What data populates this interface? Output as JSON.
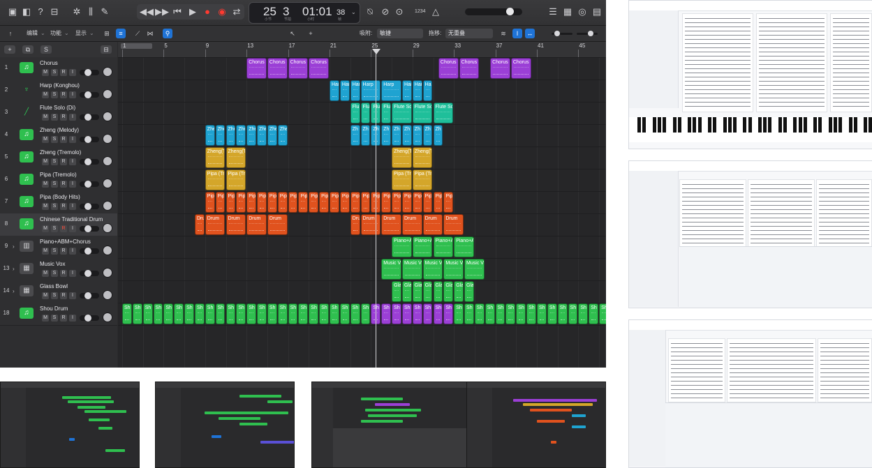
{
  "transport": {
    "bars": "25",
    "beats": "3",
    "time": "01:01",
    "frames": "38",
    "bars_label": "小节",
    "beats_label": "节拍",
    "time_label": "小时",
    "frames_label": "帧",
    "sig": "1234",
    "key_sig": "4"
  },
  "toolbar": {
    "edit": "编辑",
    "functions": "功能",
    "view": "显示",
    "snap_label": "吸附:",
    "snap_value": "敏捷",
    "drag_label": "拖移:",
    "drag_value": "无重叠"
  },
  "ruler": [
    "1",
    "5",
    "9",
    "13",
    "17",
    "21",
    "25",
    "29",
    "33",
    "37",
    "41",
    "45"
  ],
  "tracks": [
    {
      "num": "1",
      "name": "Chorus",
      "icon": "music-note-icon"
    },
    {
      "num": "2",
      "name": "Harp (Konghou)",
      "icon": "harp-icon"
    },
    {
      "num": "3",
      "name": "Flute Solo (Di)",
      "icon": "flute-icon"
    },
    {
      "num": "4",
      "name": "Zheng (Melody)",
      "icon": "music-note-icon"
    },
    {
      "num": "5",
      "name": "Zheng (Tremolo)",
      "icon": "music-note-icon"
    },
    {
      "num": "6",
      "name": "Pipa (Tremolo)",
      "icon": "music-note-icon"
    },
    {
      "num": "7",
      "name": "Pipa (Body Hits)",
      "icon": "music-note-icon"
    },
    {
      "num": "8",
      "name": "Chinese Traditional Drum",
      "icon": "music-note-icon"
    },
    {
      "num": "9",
      "name": "Piano+ABM+Chorus",
      "icon": "piano-icon"
    },
    {
      "num": "13",
      "name": "Music Vox",
      "icon": "keyboard-icon"
    },
    {
      "num": "14",
      "name": "Glass Bowl",
      "icon": "keyboard-icon"
    },
    {
      "num": "18",
      "name": "Shou Drum",
      "icon": "music-note-icon"
    }
  ],
  "track_buttons": {
    "mute": "M",
    "solo": "S",
    "record": "R",
    "input": "I"
  },
  "regions": [
    {
      "row": 0,
      "label": "Chorus",
      "color": "#9b3fd6",
      "bars": [
        [
          25,
          29
        ],
        [
          29,
          33
        ],
        [
          33,
          37
        ],
        [
          37,
          41
        ]
      ]
    },
    {
      "row": 0,
      "label": "Chorus",
      "color": "#9b3fd6",
      "bars": [
        [
          62,
          66
        ],
        [
          66,
          70
        ]
      ]
    },
    {
      "row": 0,
      "label": "Chorus",
      "color": "#9b3fd6",
      "bars": [
        [
          72,
          76
        ],
        [
          76,
          80
        ]
      ]
    },
    {
      "row": 1,
      "label": "Har",
      "color": "#1fa3d1",
      "bars": [
        [
          41,
          43
        ],
        [
          43,
          45
        ],
        [
          45,
          47
        ],
        [
          47,
          49
        ],
        [
          49,
          51
        ],
        [
          51,
          53
        ],
        [
          53,
          55
        ],
        [
          55,
          57
        ],
        [
          57,
          59
        ],
        [
          59,
          61
        ]
      ]
    },
    {
      "row": 1,
      "label": "Har",
      "color": "#1fa3d1",
      "bars": [
        [
          45,
          47
        ],
        [
          47,
          49
        ],
        [
          49,
          51
        ],
        [
          51,
          53
        ]
      ]
    },
    {
      "row": 1,
      "label": "Harp",
      "color": "#1fa3d1",
      "bars": [
        [
          47,
          51
        ],
        [
          51,
          55
        ]
      ]
    },
    {
      "row": 2,
      "label": "Flu",
      "color": "#1fbf9a",
      "bars": [
        [
          45,
          47
        ],
        [
          47,
          49
        ],
        [
          49,
          51
        ],
        [
          51,
          53
        ]
      ]
    },
    {
      "row": 2,
      "label": "Flute So",
      "color": "#1fbf9a",
      "bars": [
        [
          53,
          57
        ],
        [
          57,
          61
        ],
        [
          61,
          65
        ]
      ]
    },
    {
      "row": 3,
      "label": "Zhe",
      "color": "#1fa3d1",
      "bars": [
        [
          17,
          19
        ],
        [
          19,
          21
        ],
        [
          21,
          23
        ],
        [
          23,
          25
        ],
        [
          25,
          27
        ],
        [
          27,
          29
        ],
        [
          29,
          31
        ],
        [
          31,
          33
        ]
      ]
    },
    {
      "row": 3,
      "label": "Zh",
      "color": "#1fa3d1",
      "bars": [
        [
          45,
          47
        ],
        [
          47,
          49
        ],
        [
          49,
          51
        ],
        [
          51,
          53
        ],
        [
          53,
          55
        ],
        [
          55,
          57
        ],
        [
          57,
          59
        ],
        [
          59,
          61
        ],
        [
          61,
          63
        ]
      ]
    },
    {
      "row": 4,
      "label": "Zheng(Tremolo)",
      "color": "#d4a62a",
      "bars": [
        [
          17,
          21
        ],
        [
          21,
          25
        ]
      ]
    },
    {
      "row": 4,
      "label": "Zheng(Tremolo)",
      "color": "#d4a62a",
      "bars": [
        [
          53,
          57
        ],
        [
          57,
          61
        ]
      ]
    },
    {
      "row": 5,
      "label": "Pipa (Tremolo)",
      "color": "#d4a62a",
      "bars": [
        [
          17,
          21
        ],
        [
          21,
          25
        ]
      ]
    },
    {
      "row": 5,
      "label": "Pipa (Tremolo)",
      "color": "#d4a62a",
      "bars": [
        [
          53,
          57
        ],
        [
          57,
          61
        ]
      ]
    },
    {
      "row": 6,
      "label": "Pip",
      "color": "#e0521e",
      "bars": [
        [
          17,
          19
        ],
        [
          19,
          21
        ],
        [
          21,
          23
        ],
        [
          23,
          25
        ],
        [
          25,
          27
        ],
        [
          27,
          29
        ],
        [
          29,
          31
        ],
        [
          31,
          33
        ],
        [
          33,
          35
        ],
        [
          35,
          37
        ],
        [
          37,
          39
        ],
        [
          39,
          41
        ],
        [
          41,
          43
        ],
        [
          43,
          45
        ],
        [
          45,
          47
        ],
        [
          47,
          49
        ],
        [
          49,
          51
        ],
        [
          51,
          53
        ],
        [
          53,
          55
        ],
        [
          55,
          57
        ],
        [
          57,
          59
        ],
        [
          59,
          61
        ],
        [
          61,
          63
        ],
        [
          63,
          65
        ]
      ]
    },
    {
      "row": 7,
      "label": "Drum",
      "color": "#e0521e",
      "bars": [
        [
          15,
          17
        ],
        [
          17,
          21
        ],
        [
          21,
          25
        ],
        [
          25,
          29
        ],
        [
          29,
          33
        ]
      ]
    },
    {
      "row": 7,
      "label": "Drum",
      "color": "#e0521e",
      "bars": [
        [
          45,
          47
        ],
        [
          47,
          51
        ],
        [
          51,
          55
        ],
        [
          55,
          59
        ],
        [
          59,
          63
        ],
        [
          63,
          67
        ]
      ]
    },
    {
      "row": 8,
      "label": "Piano+A",
      "color": "#2fbf4f",
      "bars": [
        [
          53,
          57
        ],
        [
          57,
          61
        ],
        [
          61,
          65
        ],
        [
          65,
          69
        ]
      ]
    },
    {
      "row": 9,
      "label": "Music V",
      "color": "#2fbf4f",
      "bars": [
        [
          51,
          55
        ],
        [
          55,
          59
        ],
        [
          59,
          63
        ],
        [
          63,
          67
        ],
        [
          67,
          71
        ]
      ]
    },
    {
      "row": 10,
      "label": "Gla",
      "color": "#2fbf4f",
      "bars": [
        [
          53,
          55
        ],
        [
          55,
          57
        ],
        [
          57,
          59
        ],
        [
          59,
          61
        ],
        [
          61,
          63
        ],
        [
          63,
          65
        ],
        [
          65,
          67
        ],
        [
          67,
          69
        ]
      ]
    },
    {
      "row": 11,
      "label": "Sh",
      "color": "#2fbf4f",
      "bars": "full"
    }
  ],
  "thumbnails": [
    "logic-screenshot-1",
    "logic-screenshot-2",
    "logic-screenshot-3",
    "logic-screenshot-4"
  ],
  "colors": {
    "green": "#2fbf4f",
    "purple": "#9b3fd6",
    "cyan": "#1fa3d1",
    "teal": "#1fbf9a",
    "yellow": "#d4a62a",
    "orange": "#e0521e"
  }
}
